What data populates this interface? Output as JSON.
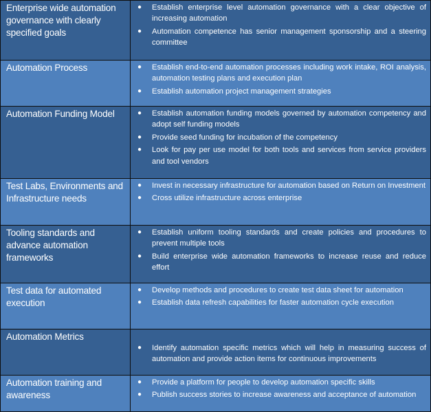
{
  "table": {
    "bullet_glyph": "●",
    "colors": {
      "dark_row": "#366092",
      "light_row": "#4f81bd",
      "text": "#ffffff",
      "border": "#0d0d0d"
    },
    "rows": [
      {
        "area": "Enterprise wide automation governance with clearly specified goals",
        "points": [
          "Establish enterprise level automation governance with a clear objective of increasing automation",
          "Automation competence has senior management sponsorship and a steering committee"
        ]
      },
      {
        "area": "Automation Process",
        "points": [
          "Establish end-to-end automation processes including work intake, ROI analysis, automation testing plans and execution plan",
          "Establish automation project management strategies"
        ]
      },
      {
        "area": "Automation Funding Model",
        "points": [
          "Establish automation funding models governed by automation competency and adopt self funding models",
          "Provide seed funding for incubation of the competency",
          "Look for pay per use model for both tools and services from service providers and tool vendors"
        ]
      },
      {
        "area": "Test Labs, Environments and Infrastructure needs",
        "points": [
          "Invest in necessary infrastructure for automation based on Return on Investment",
          "Cross utilize infrastructure across enterprise"
        ]
      },
      {
        "area": "Tooling standards and advance automation frameworks",
        "points": [
          "Establish uniform tooling standards and create policies and procedures to prevent multiple tools",
          "Build enterprise wide automation frameworks to increase reuse and reduce effort"
        ]
      },
      {
        "area": "Test data for automated execution",
        "points": [
          "Develop methods and procedures to create test data sheet for automation",
          "Establish data refresh capabilities for faster automation cycle execution"
        ]
      },
      {
        "area": "Automation Metrics",
        "points": [
          "Identify automation specific metrics which will help in measuring success of automation and provide action items for continuous improvements"
        ]
      },
      {
        "area": "Automation training and awareness",
        "points": [
          "Provide a platform for people to develop automation specific skills",
          "Publish success stories to increase awareness and acceptance of automation"
        ]
      }
    ]
  }
}
